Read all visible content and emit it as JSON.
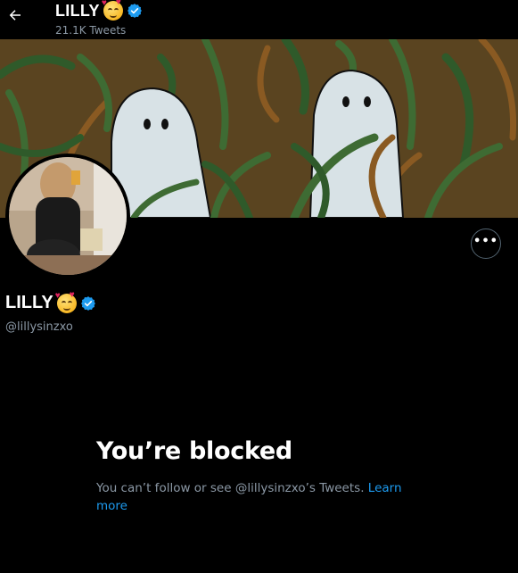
{
  "header": {
    "name": "LILLY",
    "tweet_count": "21.1K Tweets"
  },
  "icons": {
    "back": "arrow-left-icon",
    "verified": "verified-badge-icon",
    "more": "more-horizontal-icon",
    "emoji": "smiling-face-with-hearts-emoji"
  },
  "profile": {
    "name": "LILLY",
    "handle": "@lillysinzxo"
  },
  "blocked": {
    "title": "You’re blocked",
    "message": "You can’t follow or see @lillysinzxo’s Tweets.",
    "link_label": "Learn more"
  },
  "colors": {
    "background": "#000000",
    "muted_text": "#8b98a5",
    "link": "#1d9bf0",
    "verified": "#1d9bf0"
  }
}
